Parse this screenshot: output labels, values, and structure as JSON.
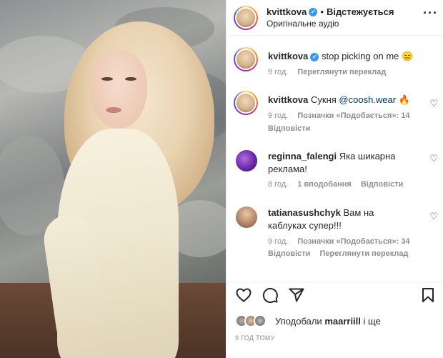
{
  "header": {
    "username": "kvittkova",
    "separator": "•",
    "follow_status": "Відстежується",
    "audio": "Оригінальне аудіо",
    "more_icon": "more-horizontal-icon"
  },
  "caption": {
    "username": "kvittkova",
    "text": "stop picking on me 😑",
    "time": "9 год.",
    "translate": "Переглянути переклад"
  },
  "comments": [
    {
      "username": "kvittkova",
      "text_before": "Сукня ",
      "mention": "@coosh.wear",
      "emoji": "🔥",
      "time": "9 год.",
      "likes": "Позначки «Подобається»: 14",
      "reply": "Відповісти"
    },
    {
      "username": "reginna_falengi",
      "text": "Яка шикарна реклама!",
      "time": "8 год.",
      "likes": "1 вподобання",
      "reply": "Відповісти"
    },
    {
      "username": "tatianasushchyk",
      "text": "Вам на каблуках супер!!!",
      "time": "9 год.",
      "likes": "Позначки «Подобається»: 34",
      "reply": "Відповісти",
      "translate": "Переглянути переклад"
    }
  ],
  "actions": {
    "like_icon": "heart-icon",
    "comment_icon": "comment-icon",
    "share_icon": "send-icon",
    "save_icon": "bookmark-icon"
  },
  "likes": {
    "prefix": "Уподобали ",
    "user": "maarriill",
    "suffix": " і ще"
  },
  "post_time": "9 ГОД ТОМУ"
}
